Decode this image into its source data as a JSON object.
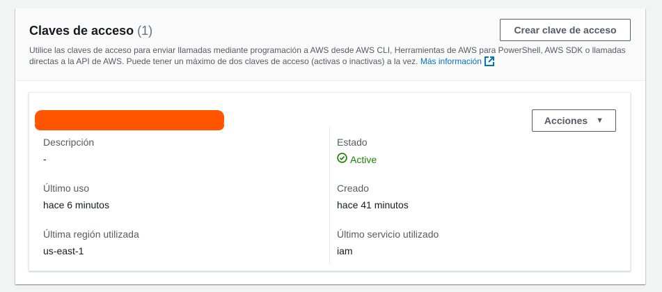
{
  "section": {
    "title": "Claves de acceso",
    "count": "(1)",
    "description": "Utilice las claves de acceso para enviar llamadas mediante programación a AWS desde AWS CLI, Herramientas de AWS para PowerShell, AWS SDK o llamadas directas a la API de AWS. Puede tener un máximo de dos claves de acceso (activas o inactivas) a la vez.",
    "more_info_link": "Más información",
    "create_button": "Crear clave de acceso"
  },
  "access_key": {
    "actions_button": "Acciones",
    "fields": {
      "description_label": "Descripción",
      "description_value": "-",
      "last_used_label": "Último uso",
      "last_used_value": "hace 6 minutos",
      "last_region_label": "Última región utilizada",
      "last_region_value": "us-east-1",
      "status_label": "Estado",
      "status_value": "Active",
      "created_label": "Creado",
      "created_value": "hace 41 minutos",
      "last_service_label": "Último servicio utilizado",
      "last_service_value": "iam"
    }
  },
  "colors": {
    "link": "#0073bb",
    "success": "#1d8102",
    "redaction": "#ff5500",
    "button_border": "#545b64"
  },
  "icons": {
    "external_link": "external-link-icon",
    "status": "check-circle-icon",
    "dropdown": "caret-down-icon"
  }
}
